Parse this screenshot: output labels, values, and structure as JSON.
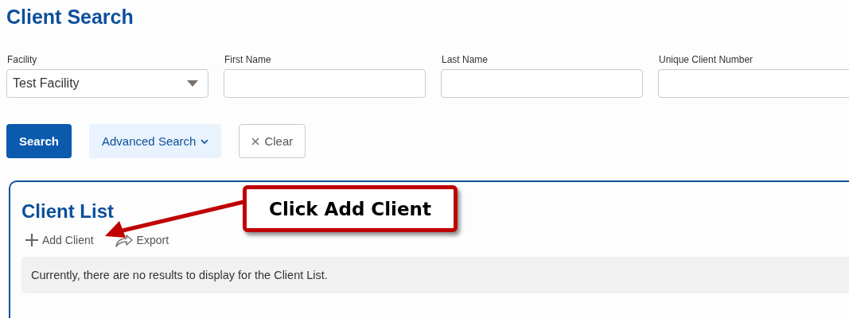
{
  "title": "Client Search",
  "fields": [
    {
      "label": "Facility",
      "kind": "select",
      "value": "Test Facility"
    },
    {
      "label": "First Name",
      "kind": "text"
    },
    {
      "label": "Last Name",
      "kind": "text"
    },
    {
      "label": "Unique Client Number",
      "kind": "text"
    }
  ],
  "buttons": [
    {
      "label": "Search",
      "kind": "primary"
    },
    {
      "label": "Advanced Search",
      "kind": "secondary"
    },
    {
      "label": "Clear",
      "kind": "clear"
    }
  ],
  "panel": {
    "title": "Client List",
    "actions": [
      {
        "label": "Add Client",
        "kind": "add"
      },
      {
        "label": "Export",
        "kind": "export"
      }
    ],
    "message": "Currently, there are no results to display for the Client List."
  },
  "callout": {
    "text": "Click Add Client"
  }
}
